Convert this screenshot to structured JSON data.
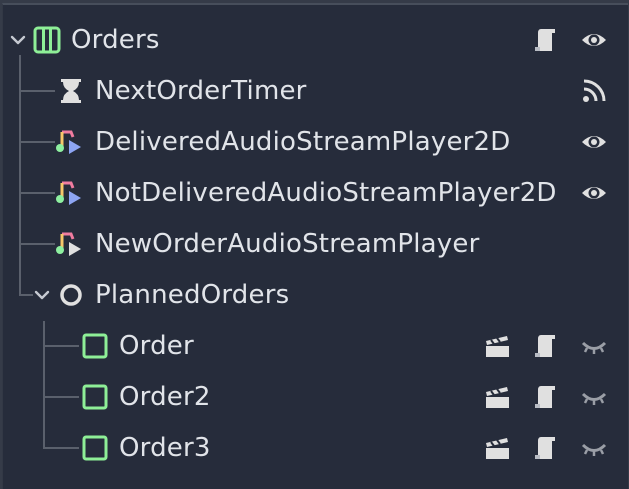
{
  "scene_tree": {
    "nodes": [
      {
        "name": "Orders",
        "type_icon": "grid-container-icon",
        "expanded": true,
        "actions": [
          "script-icon",
          "visibility-eye-icon"
        ]
      },
      {
        "name": "NextOrderTimer",
        "type_icon": "hourglass-timer-icon",
        "actions": [
          "signal-connections-icon"
        ]
      },
      {
        "name": "DeliveredAudioStreamPlayer2D",
        "type_icon": "audio-stream-player-icon",
        "actions": [
          "visibility-eye-icon"
        ]
      },
      {
        "name": "NotDeliveredAudioStreamPlayer2D",
        "type_icon": "audio-stream-player-icon",
        "actions": [
          "visibility-eye-icon"
        ]
      },
      {
        "name": "NewOrderAudioStreamPlayer",
        "type_icon": "audio-stream-player-icon",
        "actions": []
      },
      {
        "name": "PlannedOrders",
        "type_icon": "node-circle-icon",
        "expanded": true,
        "actions": []
      },
      {
        "name": "Order",
        "type_icon": "control-panel-icon",
        "actions": [
          "open-scene-icon",
          "script-icon",
          "visibility-closed-eye-icon"
        ]
      },
      {
        "name": "Order2",
        "type_icon": "control-panel-icon",
        "actions": [
          "open-scene-icon",
          "script-icon",
          "visibility-closed-eye-icon"
        ]
      },
      {
        "name": "Order3",
        "type_icon": "control-panel-icon",
        "actions": [
          "open-scene-icon",
          "script-icon",
          "visibility-closed-eye-icon"
        ]
      }
    ]
  },
  "colors": {
    "panel_bg": "#262c3b",
    "outer_bg": "#353b48",
    "text": "#e1e4e9",
    "control_green": "#8eef97",
    "icon_gray": "#e0e0e0"
  }
}
